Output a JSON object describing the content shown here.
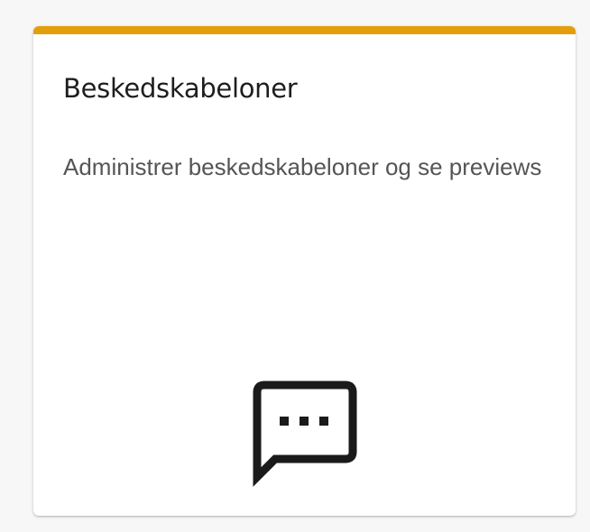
{
  "card": {
    "title": "Beskedskabeloner",
    "description": "Administrer beskedskabeloner og se previews",
    "icon": "sms-message-icon",
    "accent_color": "#e39f0b"
  }
}
